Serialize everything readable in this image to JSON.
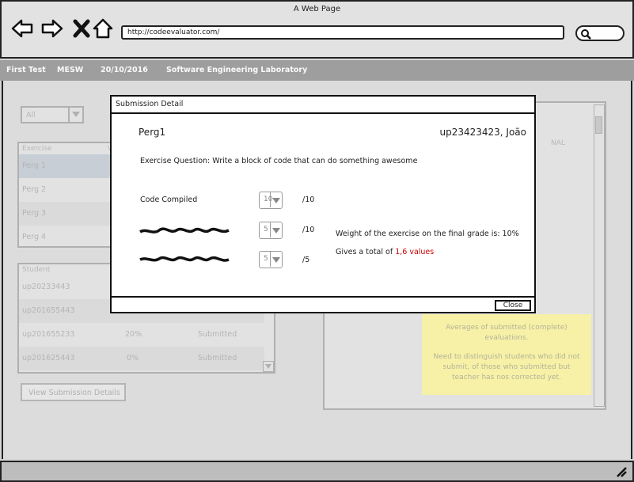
{
  "browser": {
    "window_title": "A Web Page",
    "url": "http://codeevaluator.com/"
  },
  "appbar": {
    "items": [
      "First Test",
      "MESW",
      "20/10/2016",
      "Software Engineering Laboratory"
    ]
  },
  "background": {
    "filter_value": "All",
    "exercise_header": "Exercise",
    "exercise_header_partial": "W",
    "exercises": [
      "Perg 1",
      "Perg 2",
      "Perg 3",
      "Perg 4"
    ],
    "student_header": "Student",
    "students": [
      {
        "id": "up20233443",
        "pct": "",
        "status": ""
      },
      {
        "id": "up201655443",
        "pct": "",
        "status": ""
      },
      {
        "id": "up201655233",
        "pct": "20%",
        "status": "Submitted"
      },
      {
        "id": "up201625443",
        "pct": "0%",
        "status": "Submitted"
      }
    ],
    "view_details_label": "View Submission Details",
    "right_partial_text_1": "NAL",
    "sticky_note": {
      "line1": "Averages of submitted (complete) evaluations.",
      "line2": "Need to distinguish students who did not submit, of those who submitted but teacher has nos corrected yet."
    }
  },
  "modal": {
    "title": "Submission Detail",
    "exercise": "Perg1",
    "student": "up23423423, João",
    "question": "Exercise Question: Write a block of code that can do something awesome",
    "rows": [
      {
        "label": "Code Compiled",
        "value": "10",
        "max": "/10"
      },
      {
        "label": "",
        "value": "5",
        "max": "/10"
      },
      {
        "label": "",
        "value": "5",
        "max": "/5"
      }
    ],
    "weight_text": "Weight of the exercise on the final grade is: 10%",
    "total_prefix": "Gives a total of ",
    "total_value": "1,6 values",
    "close_label": "Close",
    "accent_color": "#cc0000"
  }
}
